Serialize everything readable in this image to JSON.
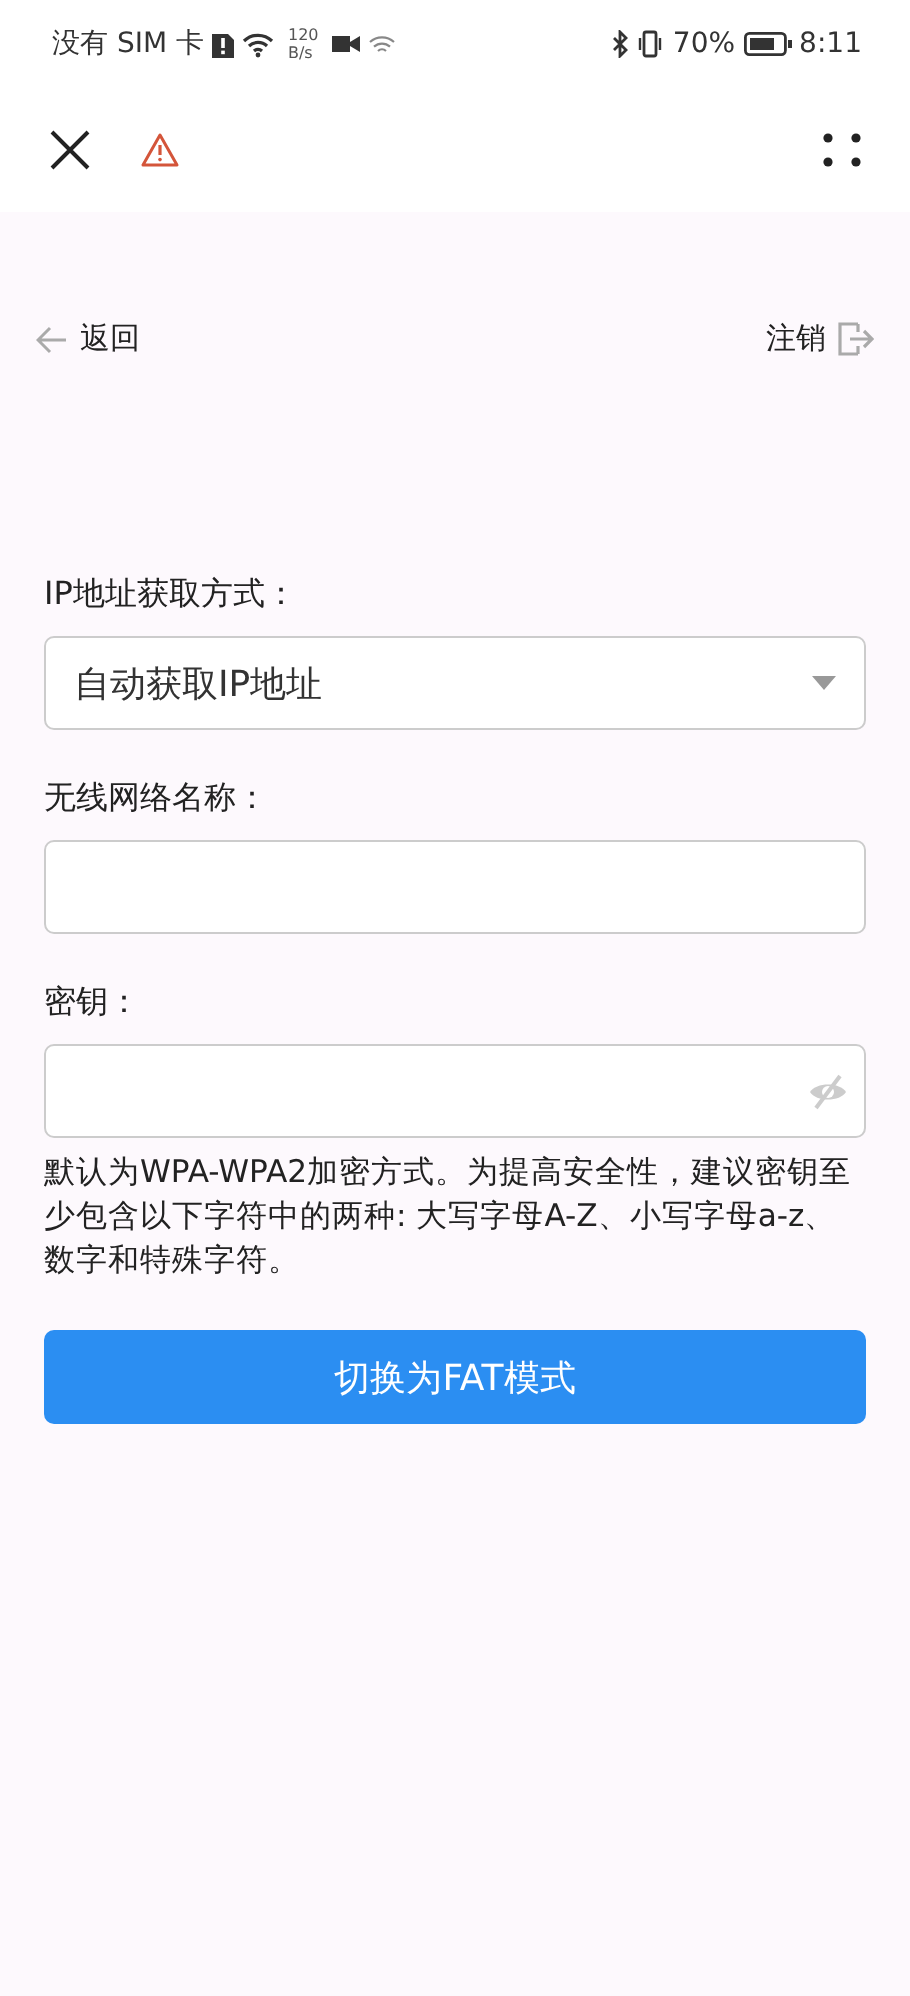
{
  "status_bar": {
    "carrier": "没有 SIM 卡",
    "speed_value": "120",
    "speed_unit": "B/s",
    "battery": "70%",
    "time": "8:11"
  },
  "nav": {
    "back": "返回",
    "logout": "注销"
  },
  "form": {
    "fields": [
      {
        "kind": "select",
        "label": "IP地址获取方式：",
        "value": "自动获取IP地址"
      },
      {
        "kind": "text",
        "label": "无线网络名称："
      },
      {
        "kind": "password",
        "label": "密钥："
      }
    ],
    "hint": "默认为WPA-WPA2加密方式。为提高安全性，建议密钥至少包含以下字符中的两种: 大写字母A-Z、小写字母a-z、数字和特殊字符。",
    "submit": "切换为FAT模式"
  }
}
